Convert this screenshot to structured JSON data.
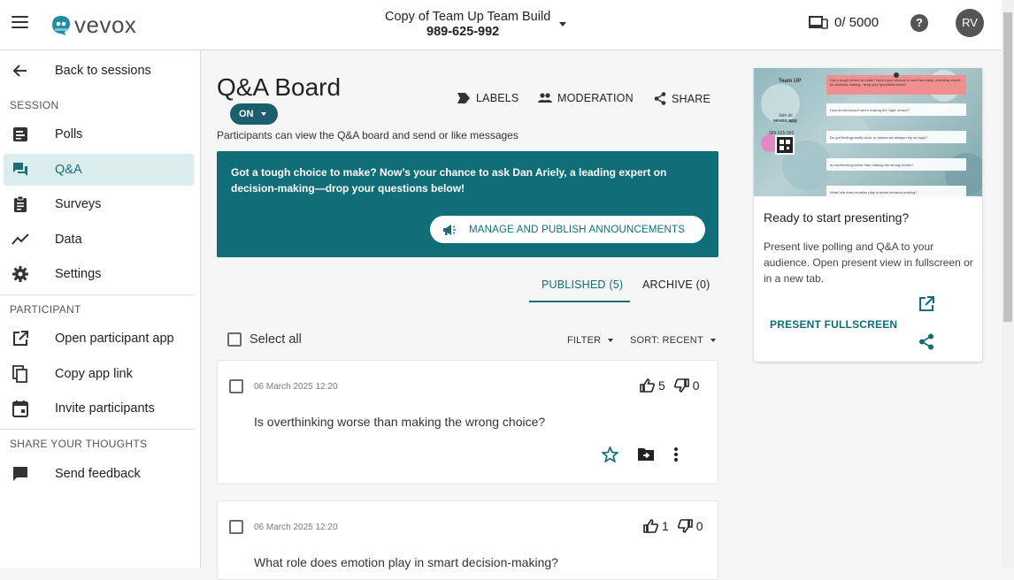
{
  "header": {
    "logo_text": "vevox",
    "session_title": "Copy of Team Up Team Build",
    "session_code": "989-625-992",
    "participants_count": "0/ 5000",
    "help_label": "?",
    "avatar_initials": "RV"
  },
  "sidebar": {
    "back_label": "Back to sessions",
    "session_section": "SESSION",
    "session_items": [
      {
        "label": "Polls",
        "icon": "polls-icon"
      },
      {
        "label": "Q&A",
        "icon": "qa-icon",
        "active": true
      },
      {
        "label": "Surveys",
        "icon": "surveys-icon"
      },
      {
        "label": "Data",
        "icon": "data-icon"
      },
      {
        "label": "Settings",
        "icon": "gear-icon"
      }
    ],
    "participant_section": "PARTICIPANT",
    "participant_items": [
      {
        "label": "Open participant app",
        "icon": "open-external-icon"
      },
      {
        "label": "Copy app link",
        "icon": "copy-icon"
      },
      {
        "label": "Invite participants",
        "icon": "calendar-icon"
      }
    ],
    "feedback_section": "SHARE YOUR THOUGHTS",
    "feedback_items": [
      {
        "label": "Send feedback",
        "icon": "feedback-icon"
      }
    ]
  },
  "main": {
    "title": "Q&A Board",
    "status_pill": "ON",
    "toolbar": {
      "labels": "LABELS",
      "moderation": "MODERATION",
      "share": "SHARE"
    },
    "description": "Participants can view the Q&A board and send or like messages",
    "announcement_text": "Got a tough choice to make? Now’s your chance to ask Dan Ariely, a leading expert on decision-making—drop your questions below!",
    "announcement_button": "MANAGE AND PUBLISH ANNOUNCEMENTS",
    "tabs": [
      {
        "label": "PUBLISHED (5)",
        "active": true
      },
      {
        "label": "ARCHIVE (0)",
        "active": false
      }
    ],
    "select_all": "Select all",
    "filter_label": "FILTER",
    "sort_label": "SORT: RECENT",
    "messages": [
      {
        "timestamp": "06 March 2025 12:20",
        "text": "Is overthinking worse than making the wrong choice?",
        "likes": "5",
        "dislikes": "0"
      },
      {
        "timestamp": "06 March 2025 12:20",
        "text": "What role does emotion play in smart decision-making?",
        "likes": "1",
        "dislikes": "0"
      }
    ]
  },
  "preview": {
    "title": "Ready to start presenting?",
    "description": "Present live polling and Q&A to your audience. Open present view in fullscreen or in a new tab.",
    "present_button": "PRESENT FULLSCREEN",
    "thumbnail": {
      "brand": "Team UP",
      "join_text": "Join at:",
      "join_url": "vevox.app",
      "code": "989-625-992",
      "banner": "Got a tough choice to make? Now's your chance to ask Dan Ariely, a leading expert on decision-making - drop your questions below!",
      "questions": [
        "How do we know if we're making the 'right' choice?",
        "Do gut feelings really work, or should we always rely on logic?",
        "Is overthinking worse than making the wrong choice?",
        "What role does emotion play in smart decision-making?"
      ]
    }
  },
  "colors": {
    "accent": "#0f6e78",
    "pill": "#1b5f6e",
    "active_nav_bg": "#dcedee"
  }
}
